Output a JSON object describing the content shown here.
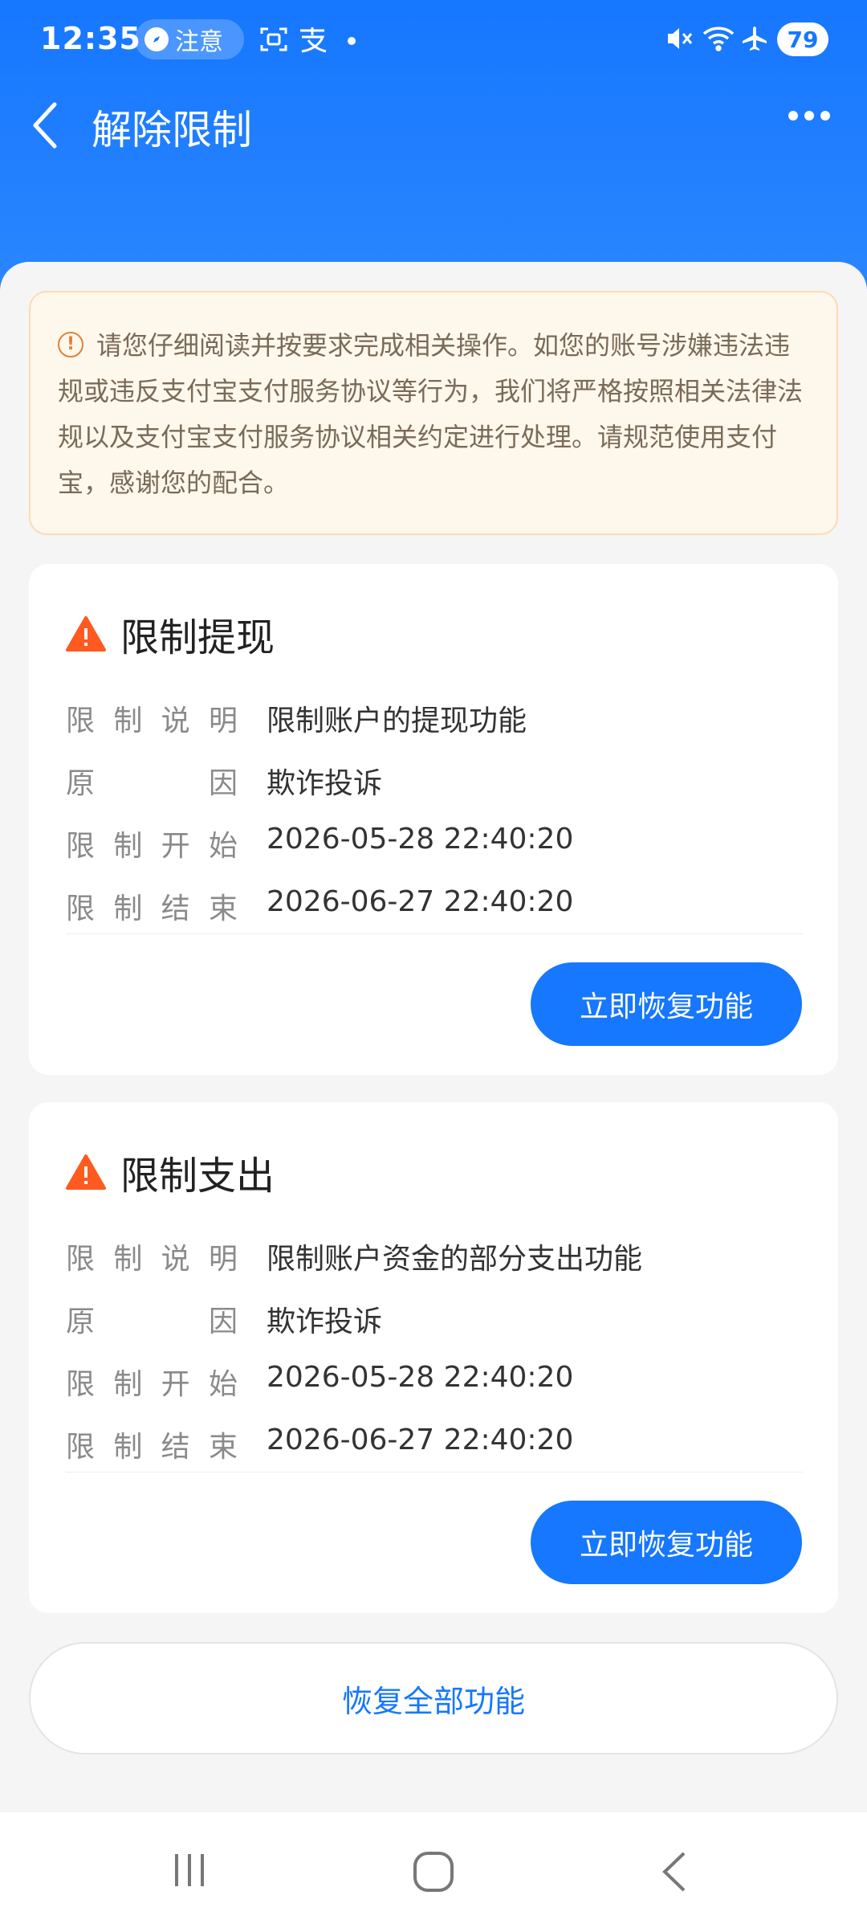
{
  "status_bar": {
    "time": "12:35",
    "notice_label": "注意",
    "battery": "79"
  },
  "header": {
    "title": "解除限制"
  },
  "warning": {
    "text": "请您仔细阅读并按要求完成相关操作。如您的账号涉嫌违法违规或违反支付宝支付服务协议等行为，我们将严格按照相关法律法规以及支付宝支付服务协议相关约定进行处理。请规范使用支付宝，感谢您的配合。"
  },
  "cards": [
    {
      "title": "限制提现",
      "rows": [
        {
          "label": [
            "限",
            "制",
            "说",
            "明"
          ],
          "value": "限制账户的提现功能"
        },
        {
          "label": [
            "原",
            "因"
          ],
          "value": "欺诈投诉"
        },
        {
          "label": [
            "限",
            "制",
            "开",
            "始"
          ],
          "value": "2026-05-28 22:40:20"
        },
        {
          "label": [
            "限",
            "制",
            "结",
            "束"
          ],
          "value": "2026-06-27 22:40:20"
        }
      ],
      "button": "立即恢复功能"
    },
    {
      "title": "限制支出",
      "rows": [
        {
          "label": [
            "限",
            "制",
            "说",
            "明"
          ],
          "value": "限制账户资金的部分支出功能"
        },
        {
          "label": [
            "原",
            "因"
          ],
          "value": "欺诈投诉"
        },
        {
          "label": [
            "限",
            "制",
            "开",
            "始"
          ],
          "value": "2026-05-28 22:40:20"
        },
        {
          "label": [
            "限",
            "制",
            "结",
            "束"
          ],
          "value": "2026-06-27 22:40:20"
        }
      ],
      "button": "立即恢复功能"
    }
  ],
  "restore_all": "恢复全部功能",
  "colors": {
    "primary": "#1677ff",
    "warning_bg": "#fef7ec",
    "warning_icon": "#ff5a1f"
  }
}
